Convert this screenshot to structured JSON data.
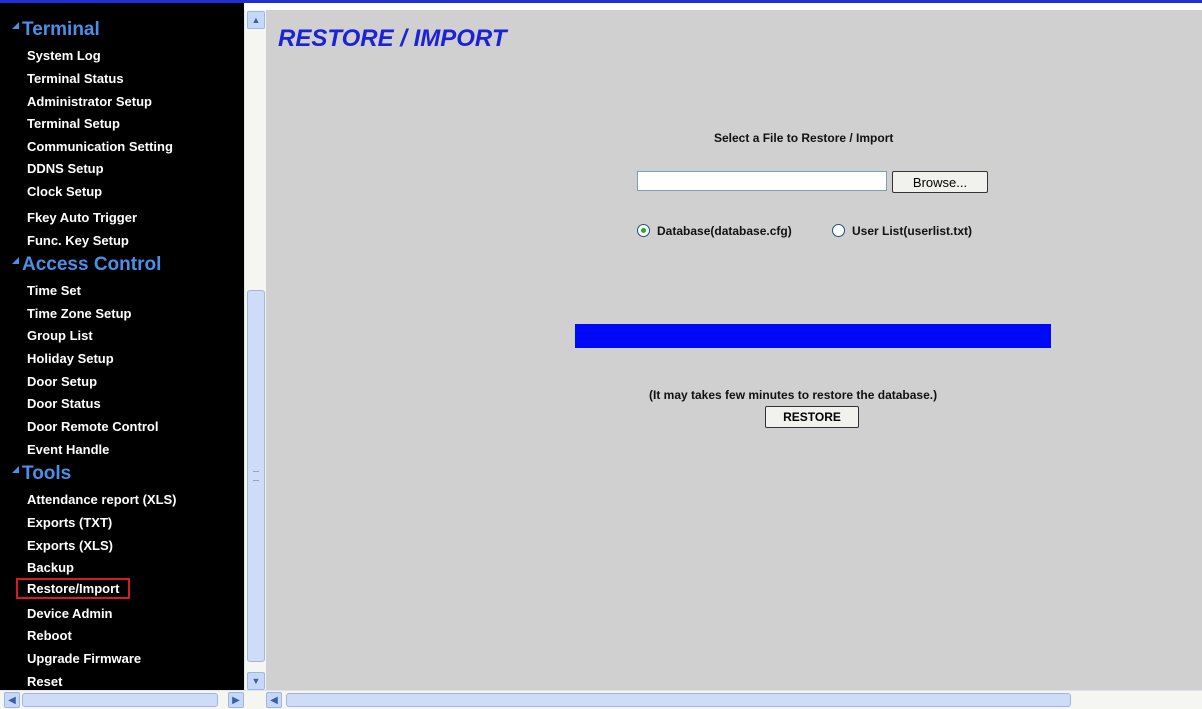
{
  "sidebar": {
    "sections": [
      {
        "label": "Terminal",
        "items": [
          "System Log",
          "Terminal Status",
          "Administrator Setup",
          "Terminal Setup",
          "Communication Setting",
          "DDNS Setup",
          "Clock Setup",
          "Fkey Auto Trigger",
          "Func. Key Setup"
        ]
      },
      {
        "label": "Access Control",
        "items": [
          "Time Set",
          "Time Zone Setup",
          "Group List",
          "Holiday Setup",
          "Door Setup",
          "Door Status",
          "Door Remote Control",
          "Event Handle"
        ]
      },
      {
        "label": "Tools",
        "items": [
          "Attendance report (XLS)",
          "Exports (TXT)",
          "Exports (XLS)",
          "Backup",
          "Restore/Import",
          "Device Admin",
          "Reboot",
          "Upgrade Firmware",
          "Reset"
        ]
      }
    ],
    "active_item": "Restore/Import"
  },
  "main": {
    "title": "RESTORE / IMPORT",
    "select_label": "Select a File to Restore / Import",
    "file_path": "",
    "browse_label": "Browse...",
    "radio_options": [
      {
        "label": "Database(database.cfg)",
        "selected": true
      },
      {
        "label": "User List(userlist.txt)",
        "selected": false
      }
    ],
    "progress": 1.0,
    "progress_color": "#0009f6",
    "note": "(It may takes few minutes to restore the database.)",
    "restore_label": "RESTORE"
  },
  "colors": {
    "title": "#1c22d6",
    "section": "#4a8fe8",
    "highlight_border": "#d61d1d",
    "main_bg": "#d0d0d0"
  }
}
